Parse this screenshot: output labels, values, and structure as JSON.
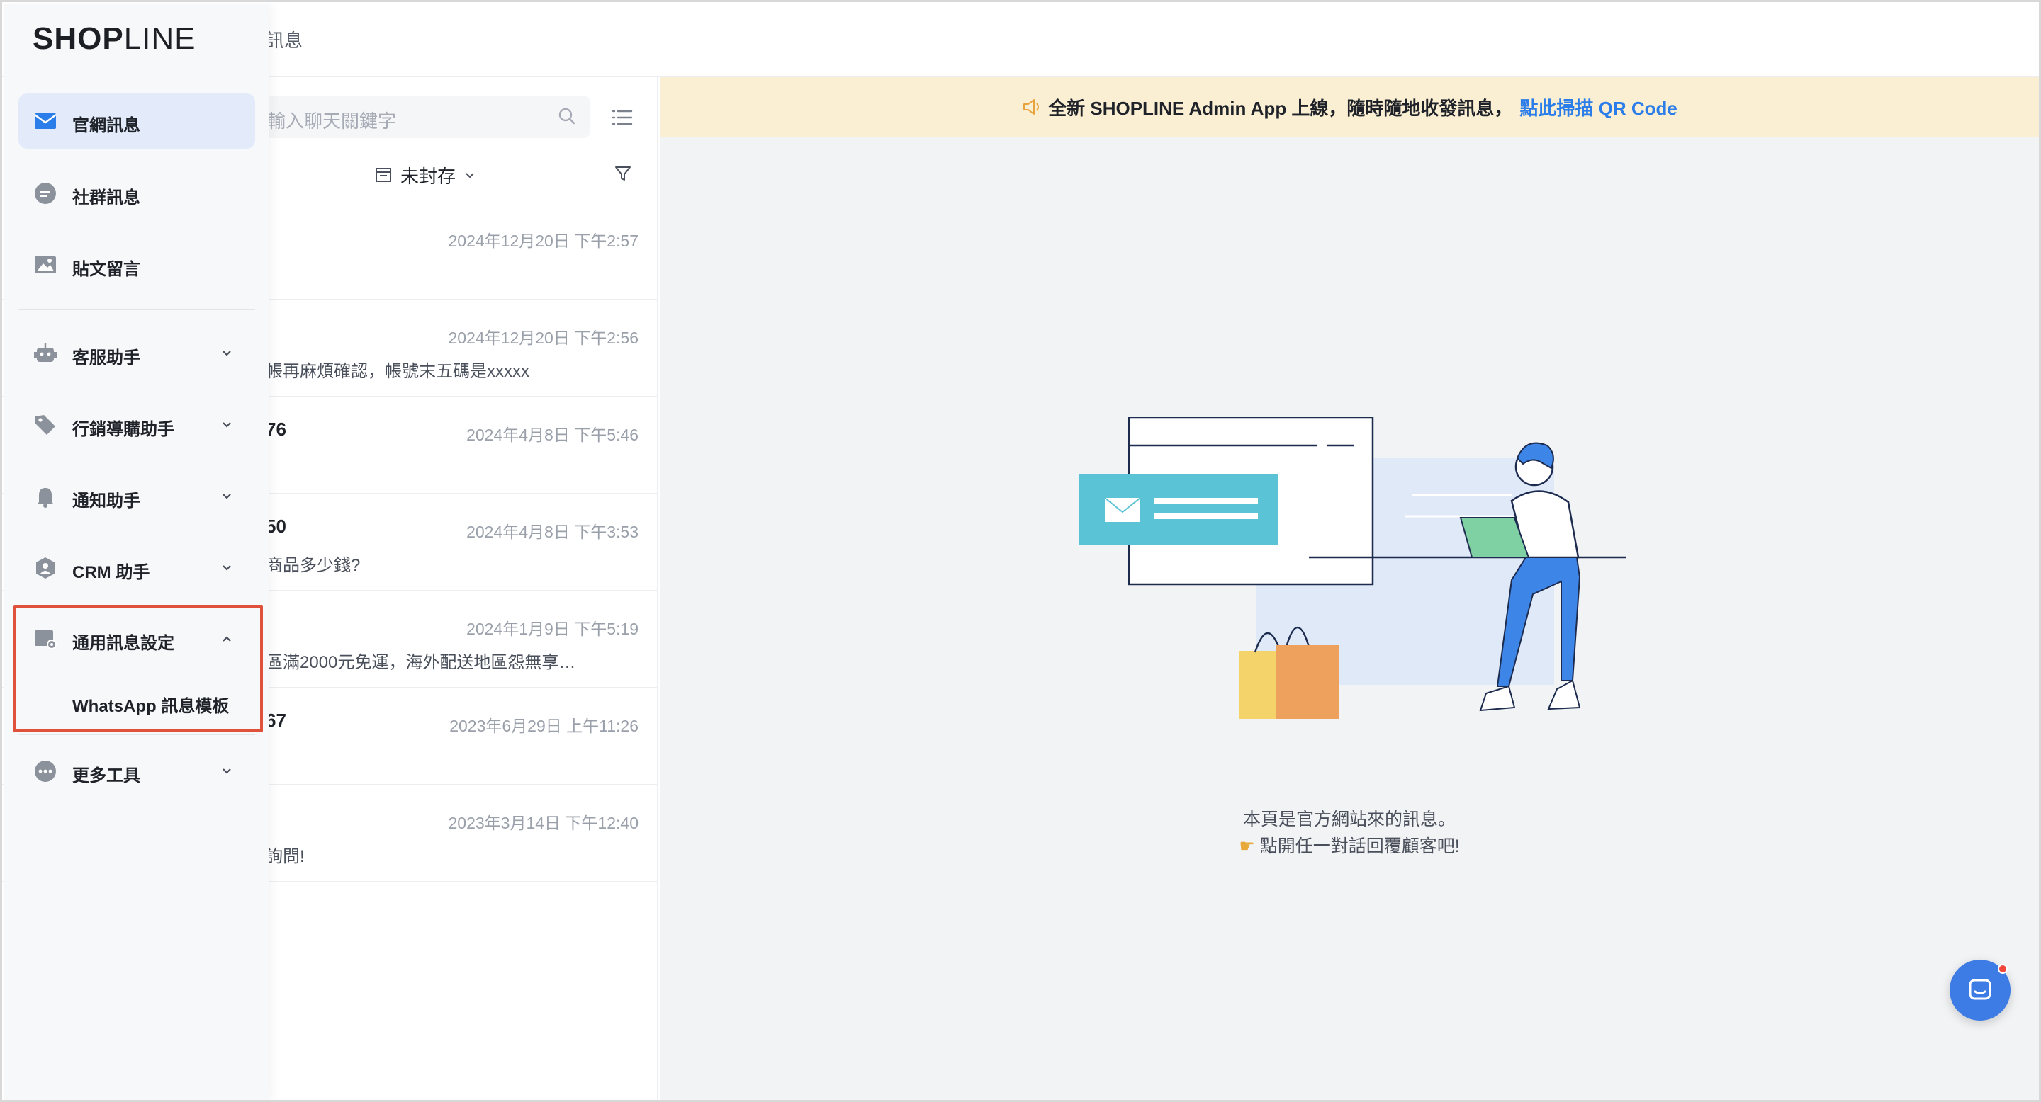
{
  "topbar": {
    "crumb": "訊息"
  },
  "sidebar": {
    "logo_a": "SHOP",
    "logo_b": "LINE",
    "items": [
      {
        "label": "官網訊息",
        "icon": "mail-icon"
      },
      {
        "label": "社群訊息",
        "icon": "chat-bubble-icon"
      },
      {
        "label": "貼文留言",
        "icon": "image-icon"
      },
      {
        "label": "客服助手",
        "icon": "robot-icon"
      },
      {
        "label": "行銷導購助手",
        "icon": "tag-icon"
      },
      {
        "label": "通知助手",
        "icon": "bell-icon"
      },
      {
        "label": "CRM 助手",
        "icon": "crm-icon"
      },
      {
        "label": "通用訊息設定",
        "icon": "message-settings-icon"
      },
      {
        "label": "更多工具",
        "icon": "more-icon"
      }
    ],
    "sub_item": "WhatsApp 訊息模板"
  },
  "list": {
    "search_placeholder": "輸入聊天關鍵字",
    "archive_label": "未封存",
    "conversations": [
      {
        "name": "",
        "time": "2024年12月20日 下午2:57",
        "preview": ""
      },
      {
        "name": "",
        "time": "2024年12月20日 下午2:56",
        "preview": "帳再麻煩確認，帳號末五碼是xxxxx"
      },
      {
        "name": "76",
        "time": "2024年4月8日 下午5:46",
        "preview": ""
      },
      {
        "name": "50",
        "time": "2024年4月8日 下午3:53",
        "preview": "商品多少錢?"
      },
      {
        "name": "",
        "time": "2024年1月9日 下午5:19",
        "preview": "區滿2000元免運，海外配送地區怨無享…"
      },
      {
        "name": "67",
        "time": "2023年6月29日 上午11:26",
        "preview": ""
      },
      {
        "name": "",
        "time": "2023年3月14日 下午12:40",
        "preview": "詢問!"
      }
    ]
  },
  "main": {
    "banner_text": "全新 SHOPLINE Admin App 上線，隨時隨地收發訊息，",
    "banner_link": "點此掃描 QR Code",
    "empty_line1": "本頁是官方網站來的訊息。",
    "empty_line2": "點開任一對話回覆顧客吧!"
  },
  "colors": {
    "accent": "#2b7de9",
    "banner_bg": "#fbefd3",
    "active_bg": "#e3ebfb",
    "highlight": "#e0513c"
  }
}
